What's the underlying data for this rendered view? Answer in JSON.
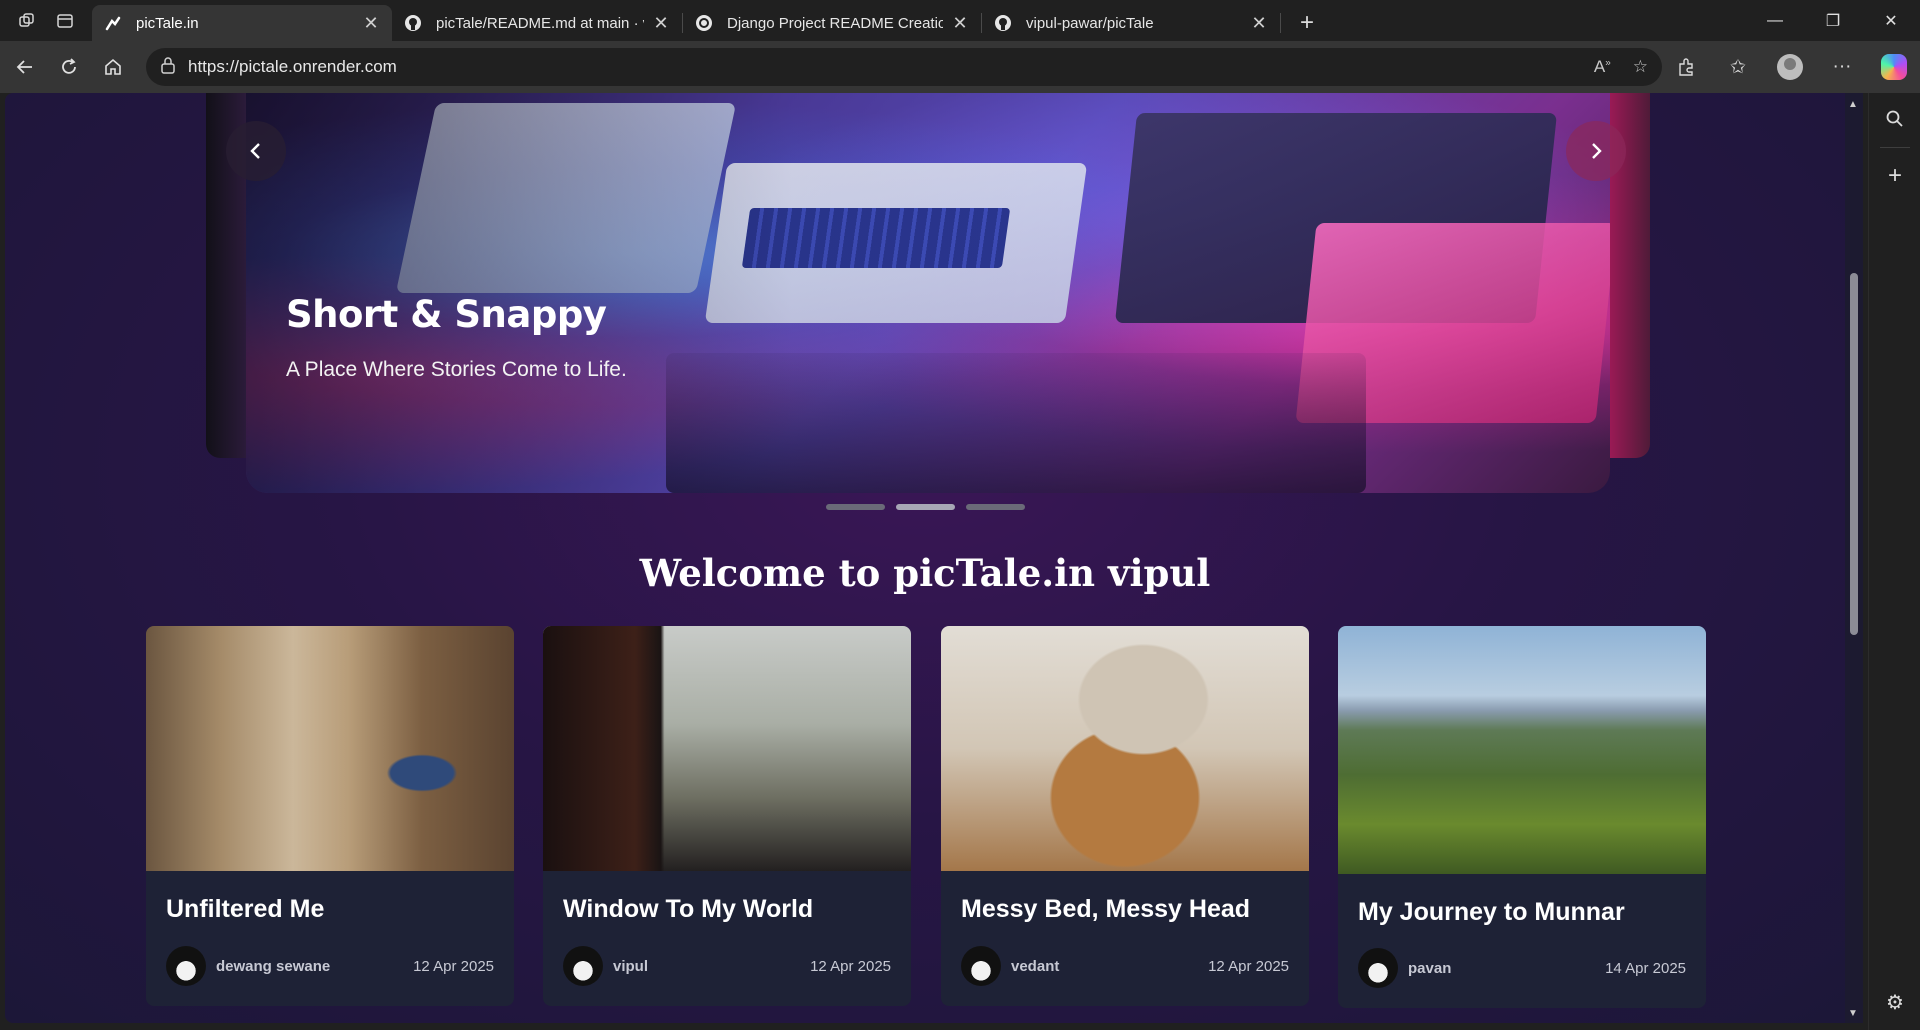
{
  "browser": {
    "tabs": [
      {
        "title": "picTale.in",
        "favicon": "pictale-logo-icon",
        "active": true
      },
      {
        "title": "picTale/README.md at main · vipul-pawar/picTale",
        "favicon": "github-icon",
        "active": false
      },
      {
        "title": "Django Project README Creation",
        "favicon": "chatgpt-icon",
        "active": false
      },
      {
        "title": "vipul-pawar/picTale",
        "favicon": "github-icon",
        "active": false
      }
    ],
    "url": "https://pictale.onrender.com",
    "window_controls": {
      "minimize": "—",
      "restore": "❐",
      "close": "✕"
    }
  },
  "hero": {
    "title": "Short & Snappy",
    "subtitle": "A Place Where Stories Come to Life.",
    "prev_label": "‹",
    "next_label": "›",
    "slides_count": 3,
    "active_slide": 2
  },
  "welcome": "Welcome to picTale.in vipul",
  "posts": [
    {
      "title": "Unfiltered Me",
      "author": "dewang sewane",
      "date": "12 Apr 2025"
    },
    {
      "title": "Window To My World",
      "author": "vipul",
      "date": "12 Apr 2025"
    },
    {
      "title": "Messy Bed, Messy Head",
      "author": "vedant",
      "date": "12 Apr 2025"
    },
    {
      "title": "My Journey to Munnar",
      "author": "pavan",
      "date": "14 Apr 2025"
    }
  ]
}
